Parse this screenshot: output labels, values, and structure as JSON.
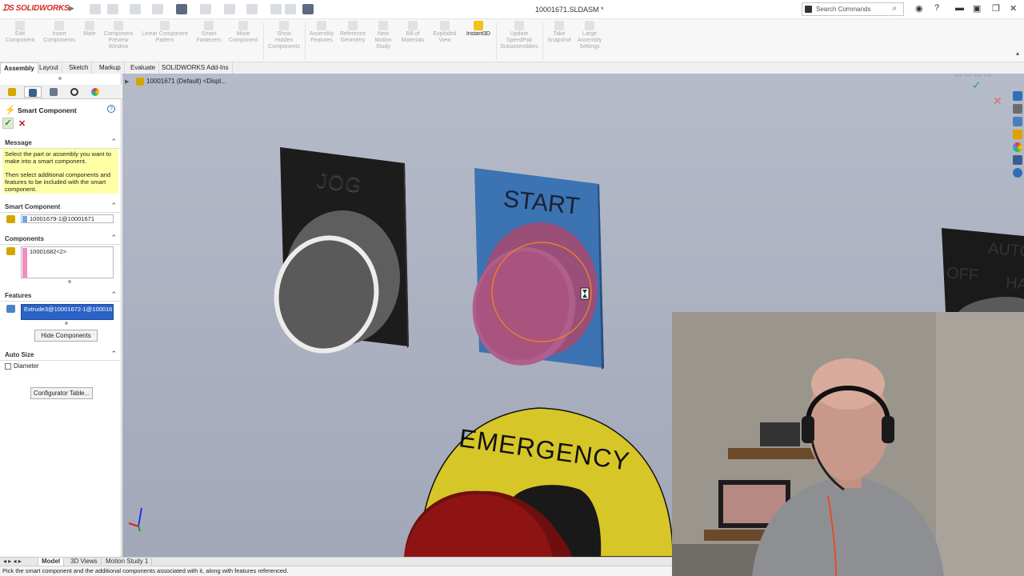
{
  "app": {
    "name": "SOLIDWORKS",
    "doc_title": "10001671.SLDASM *"
  },
  "search": {
    "placeholder": "Search Commands"
  },
  "ribbon": {
    "buttons": [
      {
        "label": "Edit\nComponent"
      },
      {
        "label": "Insert\nComponents"
      },
      {
        "label": "Mate"
      },
      {
        "label": "Component\nPreview\nWindow"
      },
      {
        "label": "Linear Component\nPattern"
      },
      {
        "label": "Smart\nFasteners"
      },
      {
        "label": "Move\nComponent"
      },
      {
        "label": "Show\nHidden\nComponents"
      },
      {
        "label": "Assembly\nFeatures"
      },
      {
        "label": "Reference\nGeometry"
      },
      {
        "label": "New\nMotion\nStudy"
      },
      {
        "label": "Bill of\nMaterials"
      },
      {
        "label": "Exploded\nView"
      },
      {
        "label": "Instant3D"
      },
      {
        "label": "Update\nSpeedPak\nSubassemblies"
      },
      {
        "label": "Take\nSnapshot"
      },
      {
        "label": "Large\nAssembly\nSettings"
      }
    ]
  },
  "command_tabs": [
    "Assembly",
    "Layout",
    "Sketch",
    "Markup",
    "Evaluate",
    "SOLIDWORKS Add-Ins"
  ],
  "panel": {
    "title": "Smart Component",
    "message_header": "Message",
    "message_1": "Select the part or assembly you want to make into a smart component.",
    "message_2": "Then select additional components and features to be included with the smart component.",
    "smart_component_header": "Smart Component",
    "smart_component_value": "10001679-1@10001671",
    "components_header": "Components",
    "components_value": "10001682<2>",
    "features_header": "Features",
    "features_value": "Extrude3@10001672-1@1000167",
    "hide_components": "Hide Components",
    "auto_size_header": "Auto Size",
    "diameter_label": "Diameter",
    "configurator_table": "Configurator Table..."
  },
  "viewport": {
    "breadcrumb": "10001671 (Default) <Displ...",
    "jog_label": "JOG",
    "start_label": "START",
    "emergency_label": "EMERGENCY",
    "auto_label": "AUTO",
    "off_label": "OFF",
    "hand_label": "HA"
  },
  "bottom_tabs": [
    "Model",
    "3D Views",
    "Motion Study 1"
  ],
  "status": "Pick the smart component and the additional components associated with it, along with features referenced.",
  "colors": {
    "accent": "#2a62c6",
    "message_bg": "#ffffa6",
    "start_plate": "#3c73b3",
    "start_button": "#b05e8c",
    "emergency_ring": "#d7c628",
    "emergency_button": "#8e1414"
  }
}
